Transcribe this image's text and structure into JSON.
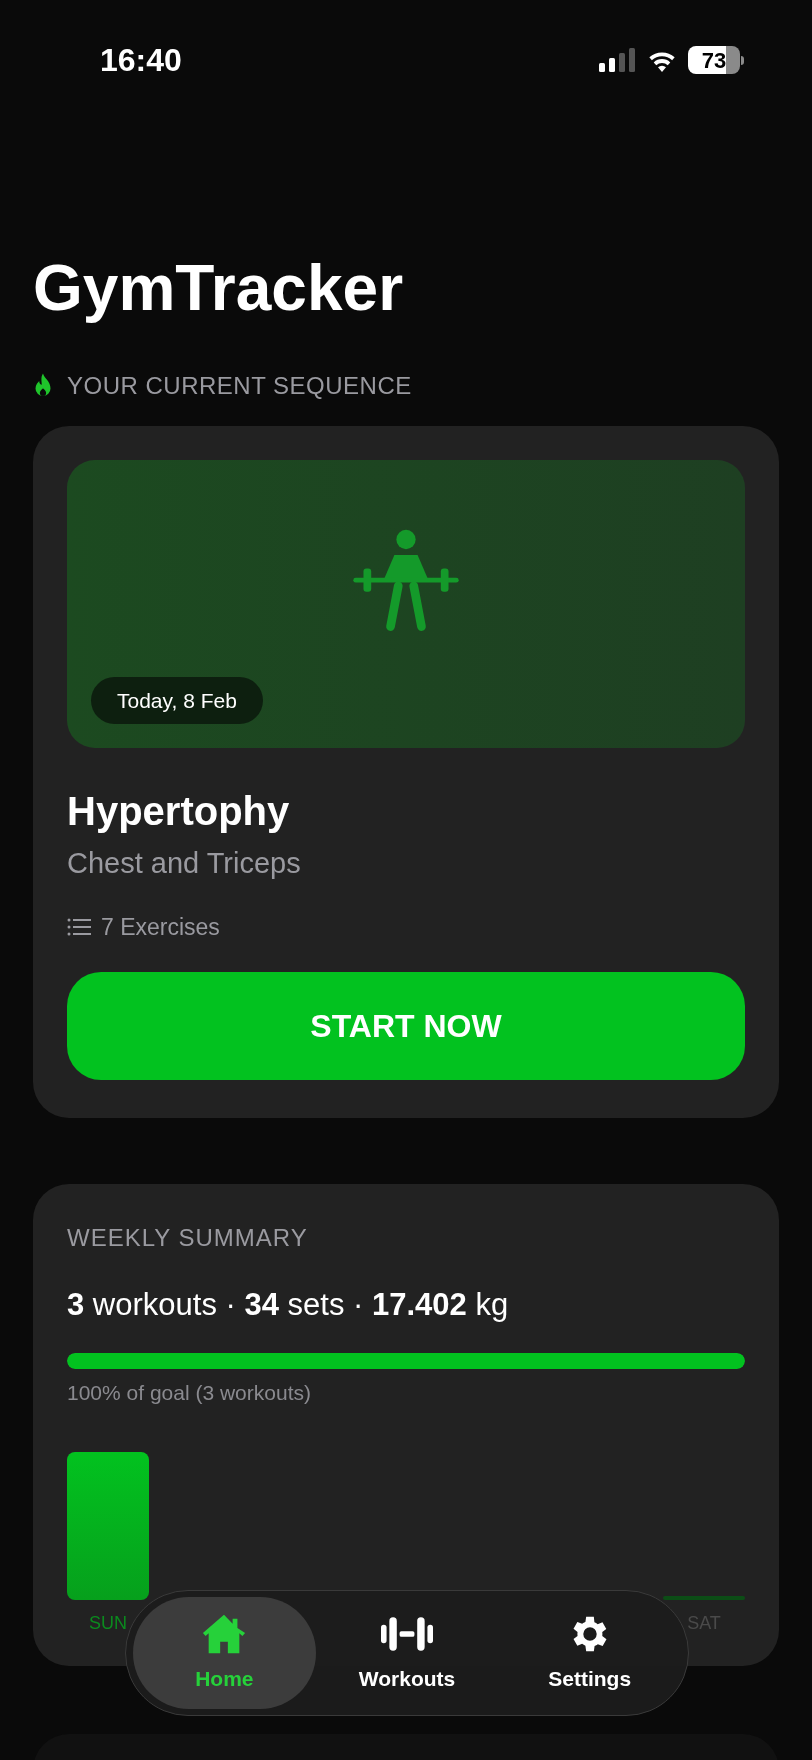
{
  "status_bar": {
    "time": "16:40",
    "battery": "73"
  },
  "app_title": "GymTracker",
  "sequence": {
    "label": "YOUR CURRENT SEQUENCE",
    "date": "Today, 8 Feb",
    "title": "Hypertophy",
    "subtitle": "Chest and Triceps",
    "exercises": "7 Exercises",
    "button": "START NOW"
  },
  "weekly_summary": {
    "title": "WEEKLY SUMMARY",
    "stats": "**3** workouts · **34** sets · **17.402** kg",
    "goal": {
      "level": 1
    },
    "goal_text": "100% of goal (3 workouts)",
    "days": [
      {
        "label": "SUN",
        "trained": true
      },
      {
        "label": "SAT",
        "trained": false
      }
    ]
  },
  "tab_bar": [
    {
      "label": "Home",
      "kind": "home",
      "selected": true
    },
    {
      "label": "Workouts",
      "kind": "workouts",
      "selected": false
    },
    {
      "label": "Settings",
      "kind": "settings",
      "selected": false
    }
  ]
}
